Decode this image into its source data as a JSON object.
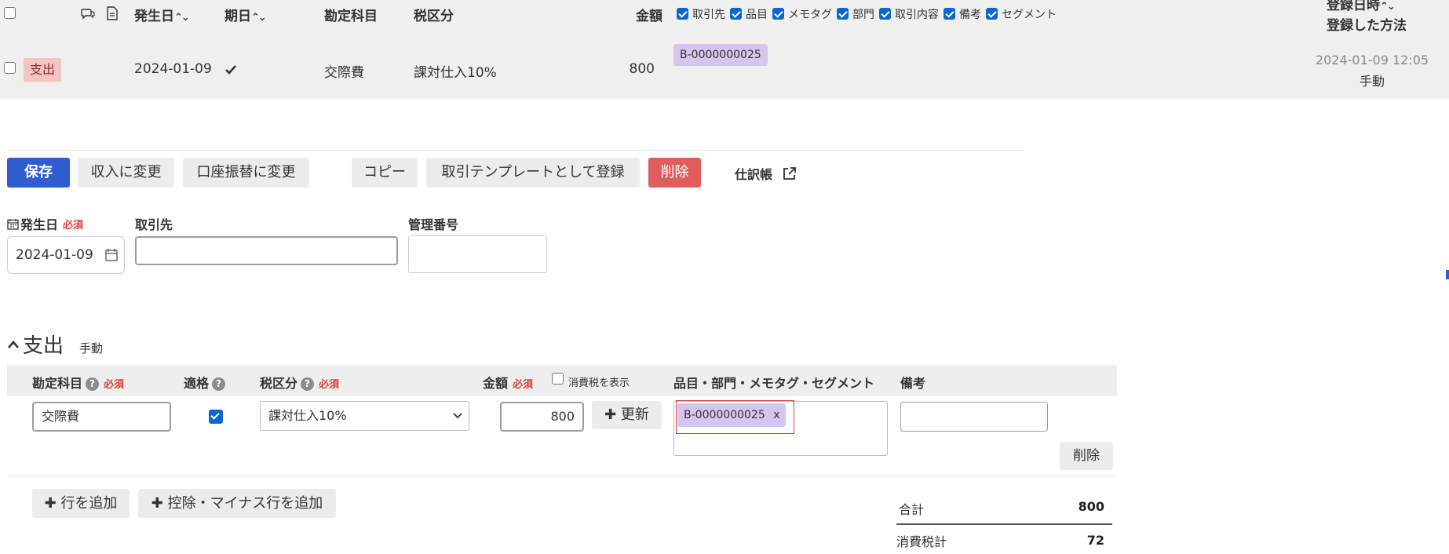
{
  "list": {
    "header": {
      "issue_date": "発生日",
      "due_date": "期日",
      "account": "勘定科目",
      "tax": "税区分",
      "amount": "金額",
      "sort_icons": "⌃⌄",
      "column_options": [
        "取引先",
        "品目",
        "メモタグ",
        "部門",
        "取引内容",
        "備考",
        "セグメント"
      ],
      "registered_at": "登録日時",
      "registered_method": "登録した方法"
    },
    "row": {
      "type_badge": "支出",
      "issue_date": "2024-01-09",
      "account": "交際費",
      "tax": "課対仕入10%",
      "amount": "800",
      "tag": "B-0000000025",
      "registered_at": "2024-01-09 12:05",
      "registered_method": "手動"
    }
  },
  "toolbar": {
    "save": "保存",
    "to_income": "収入に変更",
    "to_transfer": "口座振替に変更",
    "copy": "コピー",
    "register_template": "取引テンプレートとして登録",
    "delete": "削除",
    "journal": "仕訳帳"
  },
  "form": {
    "issue_date_label": "発生日",
    "required": "必須",
    "issue_date_value": "2024-01-09",
    "partner_label": "取引先",
    "partner_value": "",
    "mgmt_number_label": "管理番号",
    "mgmt_number_value": ""
  },
  "detail": {
    "section_title": "支出",
    "section_sub": "手動",
    "headers": {
      "account": "勘定科目",
      "qualified": "適格",
      "tax": "税区分",
      "amount": "金額",
      "show_tax": "消費税を表示",
      "tags": "品目・部門・メモタグ・セグメント",
      "memo": "備考"
    },
    "row": {
      "account": "交際費",
      "tax": "課対仕入10%",
      "amount": "800",
      "update": "更新",
      "tag": "B-0000000025",
      "tag_remove": "x",
      "delete": "削除"
    },
    "add_row": "行を追加",
    "add_minus_row": "控除・マイナス行を追加",
    "summary": {
      "total_label": "合計",
      "total_value": "800",
      "tax_label": "消費税計",
      "tax_value": "72"
    }
  },
  "colors": {
    "primary": "#2f5ccf",
    "danger": "#e05d5d",
    "expense_badge": "#f3c4c4",
    "tag": "#d4c6ee",
    "required": "#d9413a",
    "highlight": "#d9413a"
  }
}
